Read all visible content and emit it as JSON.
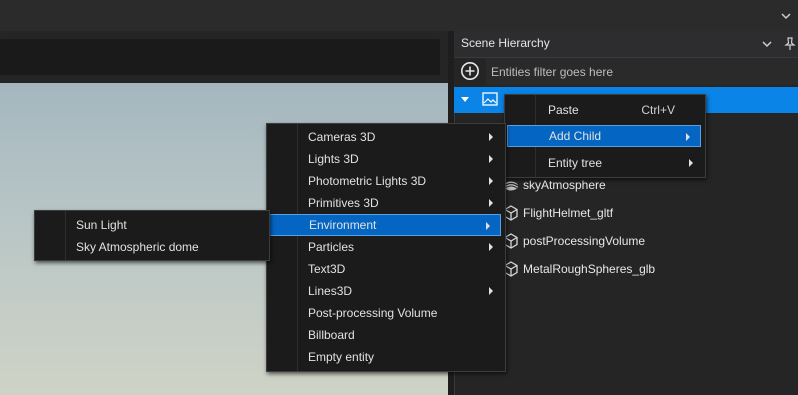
{
  "panel": {
    "title": "Scene Hierarchy",
    "filter_placeholder": "Entities filter goes here"
  },
  "entities": [
    {
      "name": "skyAtmosphere",
      "icon": "sky-atmosphere-icon"
    },
    {
      "name": "FlightHelmet_gltf",
      "icon": "mesh-entity-icon"
    },
    {
      "name": "postProcessingVolume",
      "icon": "mesh-entity-icon"
    },
    {
      "name": "MetalRoughSpheres_glb",
      "icon": "mesh-entity-icon"
    }
  ],
  "context_menu": {
    "items": [
      {
        "label": "Paste",
        "shortcut": "Ctrl+V"
      },
      {
        "label": "Add Child"
      },
      {
        "label": "Entity tree"
      }
    ]
  },
  "add_child_menu": {
    "items": [
      {
        "label": "Cameras 3D"
      },
      {
        "label": "Lights 3D"
      },
      {
        "label": "Photometric Lights 3D"
      },
      {
        "label": "Primitives 3D"
      },
      {
        "label": "Environment"
      },
      {
        "label": "Particles"
      },
      {
        "label": "Text3D"
      },
      {
        "label": "Lines3D"
      },
      {
        "label": "Post-processing Volume"
      },
      {
        "label": "Billboard"
      },
      {
        "label": "Empty entity"
      }
    ]
  },
  "environment_menu": {
    "items": [
      {
        "label": "Sun Light"
      },
      {
        "label": "Sky Atmospheric dome"
      }
    ]
  },
  "colors": {
    "selection": "#0a84e6",
    "menu_highlight": "#0466c2",
    "panel_bg": "#252526"
  }
}
